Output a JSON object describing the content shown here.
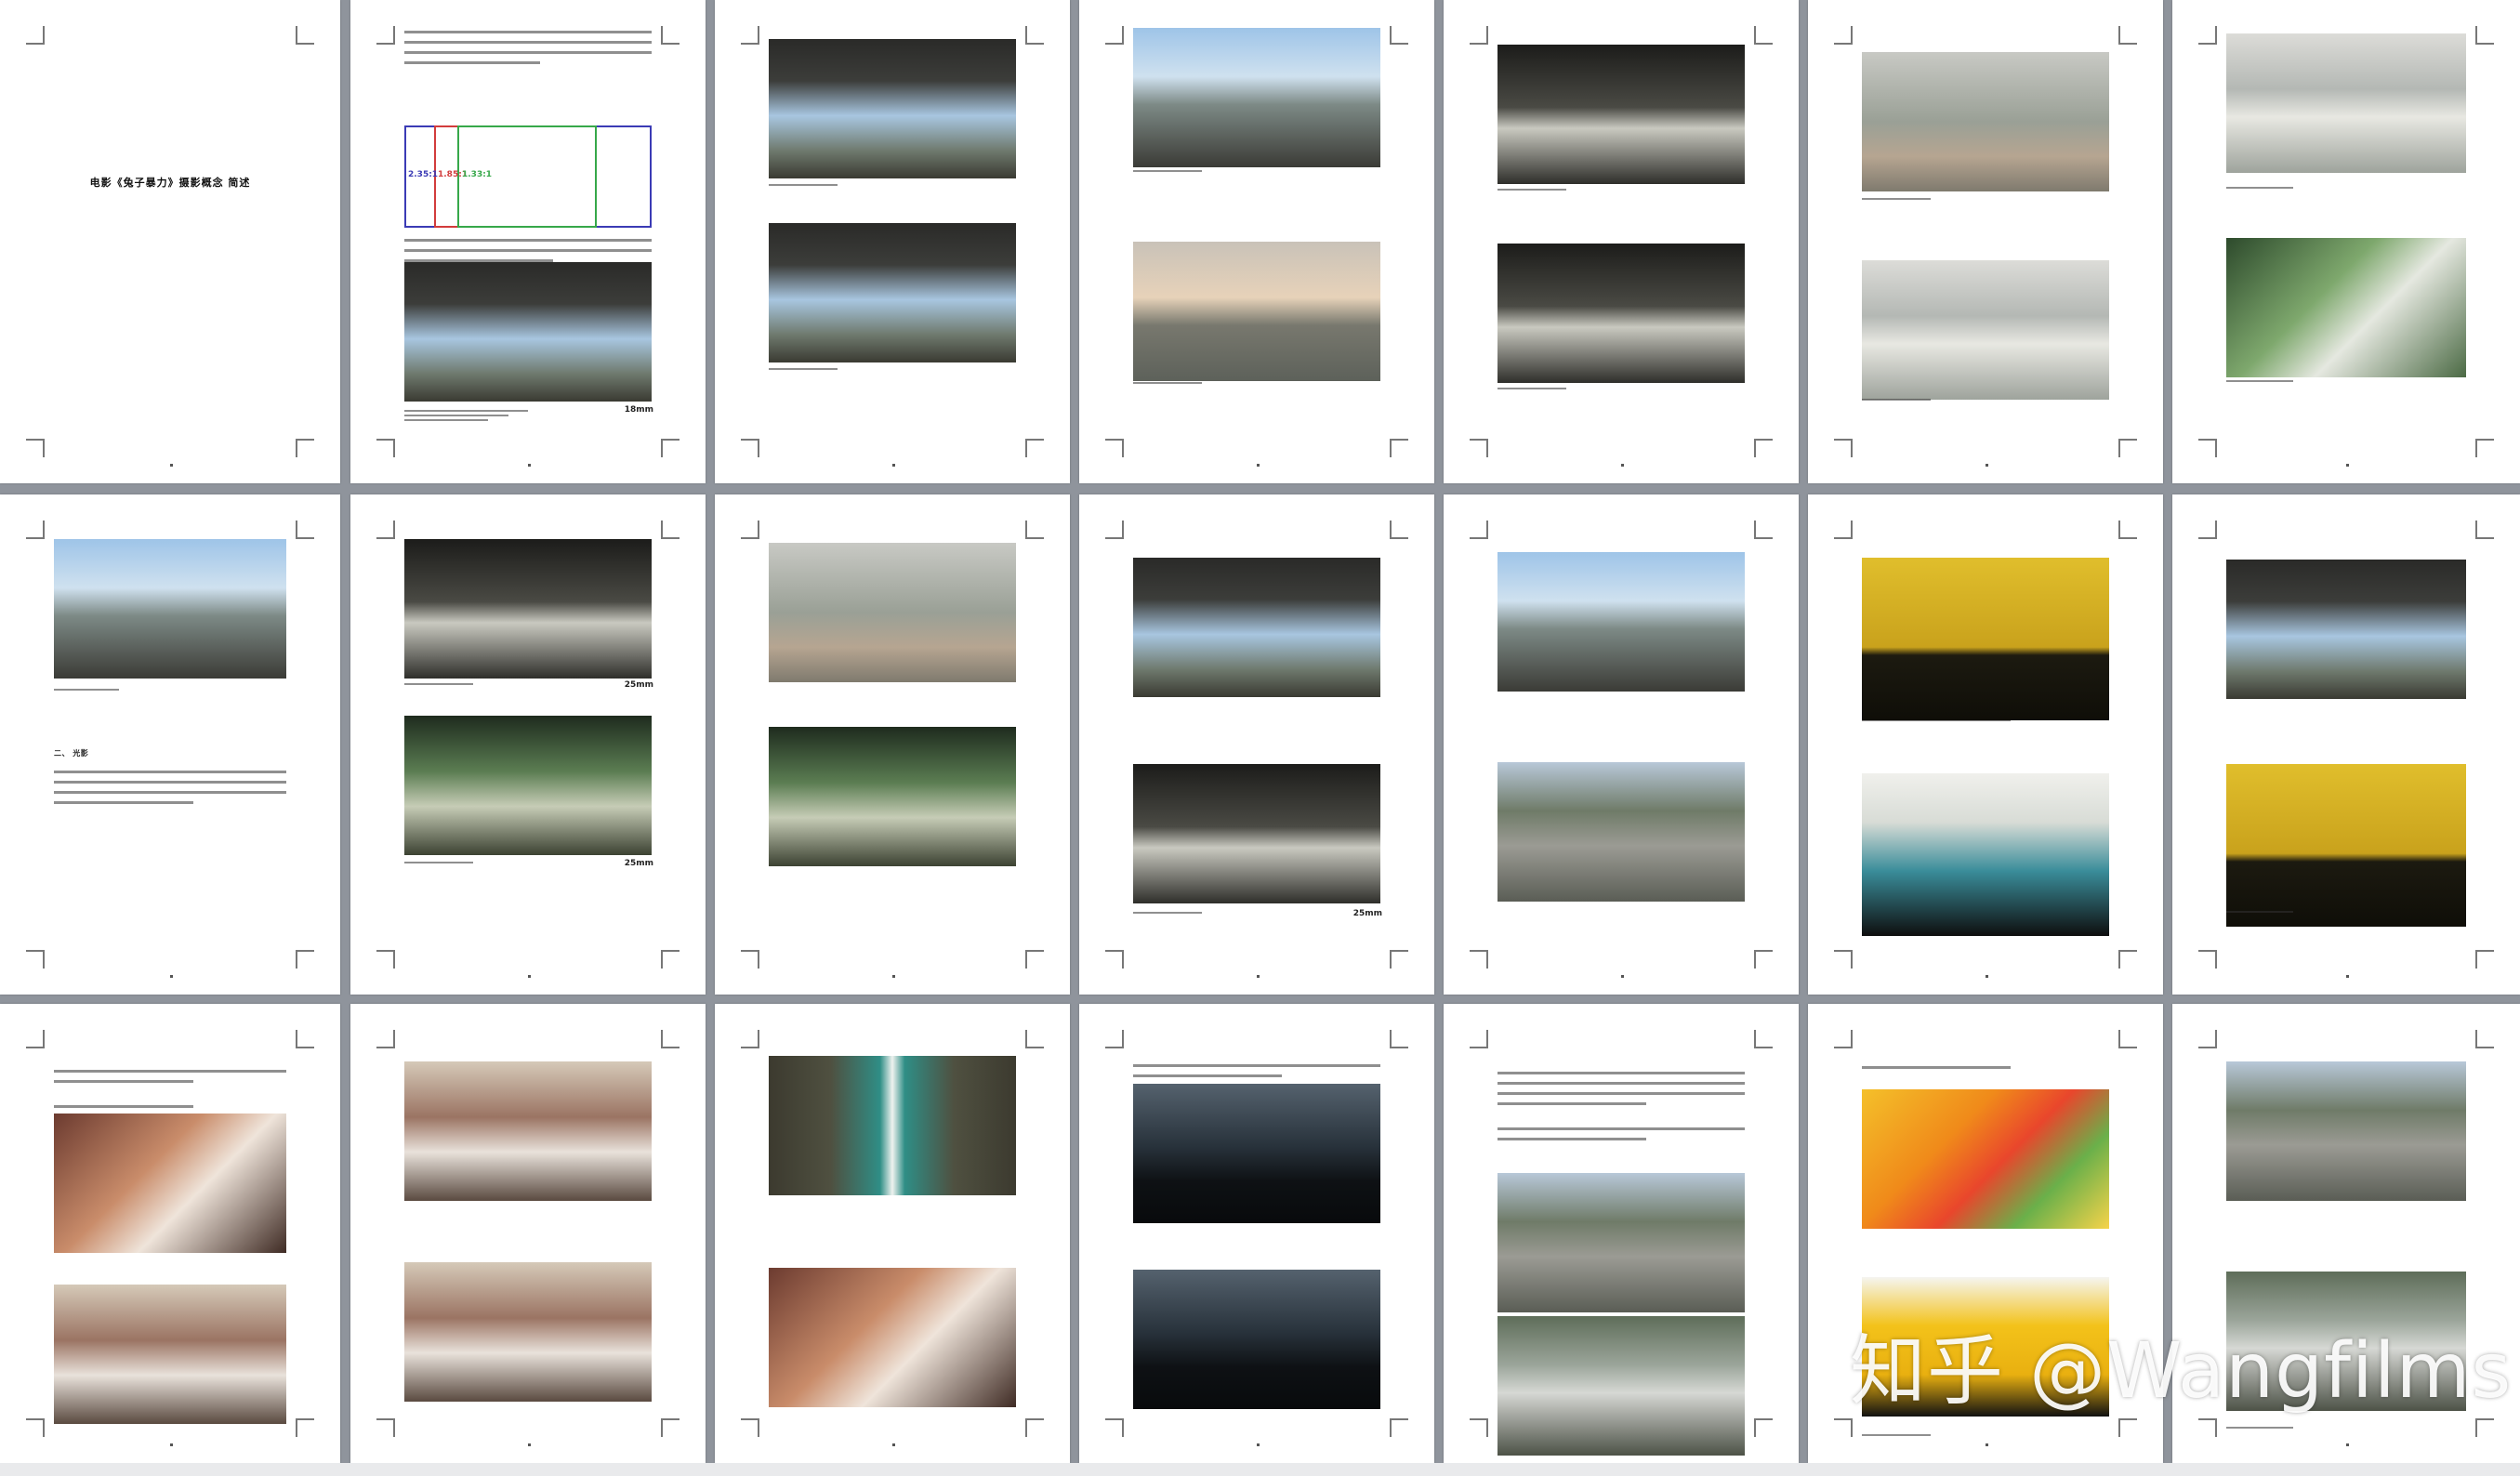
{
  "document": {
    "title": "电影《兔子暴力》摄影概念 简述",
    "ratios": [
      "2.35:1",
      "1.85:1",
      "1.33:1"
    ],
    "ratio_colors": [
      "#3b3bb5",
      "#d23c3c",
      "#37a84a"
    ],
    "lens_labels": [
      "18mm",
      "18mm",
      "25mm",
      "25mm"
    ],
    "section_two": "二、 光影",
    "watermark": "知乎 @Wangfilms"
  }
}
